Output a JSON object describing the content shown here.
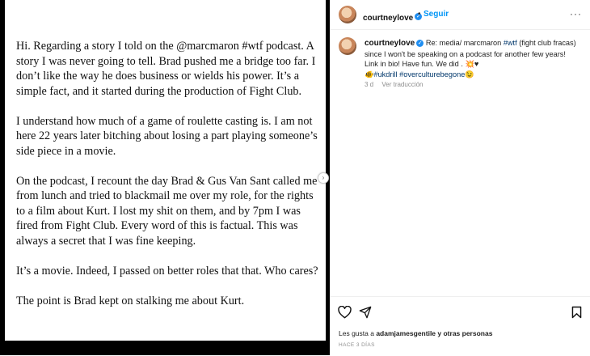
{
  "post": {
    "text_paragraphs": [
      "Hi. Regarding a story I told on the @marcmaron #wtf podcast. A story I was never going to tell. Brad pushed me a bridge too far. I don’t like the way he does business or wields his power. It’s a simple fact, and it started during the production of Fight Club.",
      "I understand how much of a game of roulette casting is. I am not here 22 years later bitching about losing a part playing  someone’s side piece in a movie.",
      "On the podcast, I recount the day Brad & Gus Van Sant called me from lunch and tried to blackmail me over my role, for the rights to a film about Kurt.  I lost my shit on them, and by 7pm I was fired from Fight Club. Every word of this is factual. This was always a secret that I was fine keeping.",
      "It’s a movie. Indeed, I passed on better roles that that. Who cares?",
      "The point is Brad kept on stalking me about Kurt."
    ]
  },
  "header": {
    "username": "courtneylove",
    "follow_label": "Seguir",
    "more_label": "···"
  },
  "caption": {
    "username": "courtneylove",
    "text_line1": "Re: media/ marcmaron",
    "hashtag1": "#wtf",
    "text_line1b": "(fight club fracas)",
    "text_line2": "since I won't be speaking on a podcast for another few years!",
    "text_line3": "Link in bio! Have fun. We did .",
    "emoji_line3": "💥♥",
    "emoji_prefix": "🐠",
    "hashtag2": "#ukdrill",
    "hashtag3": "#overculturebegone",
    "emoji_suffix": "😉",
    "time_ago": "3 d",
    "translate_label": "Ver traducción"
  },
  "footer": {
    "likes_prefix": "Les gusta a",
    "likes_user": "adamjamesgentile",
    "likes_suffix": "y otras personas",
    "posted_ago": "HACE 3 DÍAS"
  },
  "icons": {
    "like": "heart-icon",
    "share": "send-icon",
    "save": "bookmark-icon",
    "verified": "verified-badge-icon"
  },
  "colors": {
    "link": "#00376b",
    "follow": "#0095f6",
    "verified": "#1f8ef1"
  }
}
